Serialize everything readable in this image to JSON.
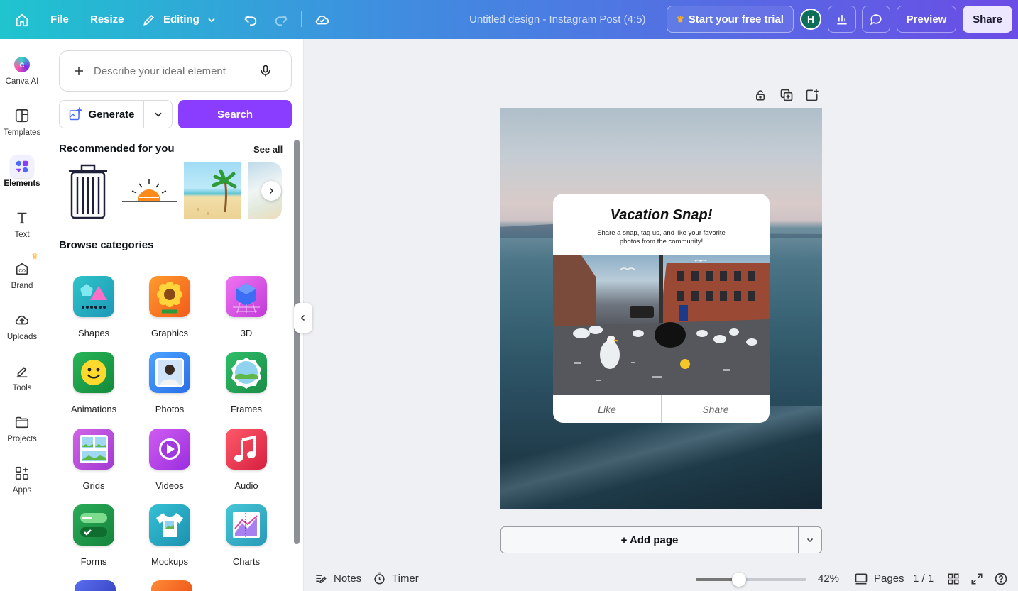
{
  "topbar": {
    "file": "File",
    "resize": "Resize",
    "editing": "Editing",
    "doc_title": "Untitled design - Instagram Post (4:5)",
    "trial": "Start your free trial",
    "avatar": "H",
    "preview": "Preview",
    "share": "Share"
  },
  "rail": [
    {
      "label": "Canva AI",
      "icon": "canva-ai-icon"
    },
    {
      "label": "Templates",
      "icon": "templates-icon"
    },
    {
      "label": "Elements",
      "icon": "elements-icon"
    },
    {
      "label": "Text",
      "icon": "text-icon"
    },
    {
      "label": "Brand",
      "icon": "brand-icon"
    },
    {
      "label": "Uploads",
      "icon": "uploads-icon"
    },
    {
      "label": "Tools",
      "icon": "tools-icon"
    },
    {
      "label": "Projects",
      "icon": "projects-icon"
    },
    {
      "label": "Apps",
      "icon": "apps-icon"
    }
  ],
  "panel": {
    "search_placeholder": "Describe your ideal element",
    "generate": "Generate",
    "search": "Search",
    "recommended": "Recommended for you",
    "see_all": "See all",
    "browse": "Browse categories",
    "categories": [
      {
        "label": "Shapes",
        "color": "#2bb7c4"
      },
      {
        "label": "Graphics",
        "color": "#ff7a1a"
      },
      {
        "label": "3D",
        "color": "#e04ce6"
      },
      {
        "label": "Animations",
        "color": "#1aa34a"
      },
      {
        "label": "Photos",
        "color": "#3a8ff0"
      },
      {
        "label": "Frames",
        "color": "#22a858"
      },
      {
        "label": "Grids",
        "color": "#c44ce0"
      },
      {
        "label": "Videos",
        "color": "#b03ee8"
      },
      {
        "label": "Audio",
        "color": "#f04050"
      },
      {
        "label": "Forms",
        "color": "#1f9a4a"
      },
      {
        "label": "Mockups",
        "color": "#29b0c6"
      },
      {
        "label": "Charts",
        "color": "#38b8c8"
      }
    ]
  },
  "design": {
    "title": "Vacation Snap!",
    "subtitle": "Share a snap, tag us, and like your favorite photos from the community!",
    "like": "Like",
    "share": "Share"
  },
  "canvas": {
    "add_page": "+ Add page"
  },
  "bottombar": {
    "notes": "Notes",
    "timer": "Timer",
    "zoom": "42%",
    "zoom_level": 0.42,
    "pages": "Pages",
    "page_count": "1 / 1"
  },
  "colors": {
    "accent": "#7d2ae8",
    "search_button": "#8b3dff"
  }
}
